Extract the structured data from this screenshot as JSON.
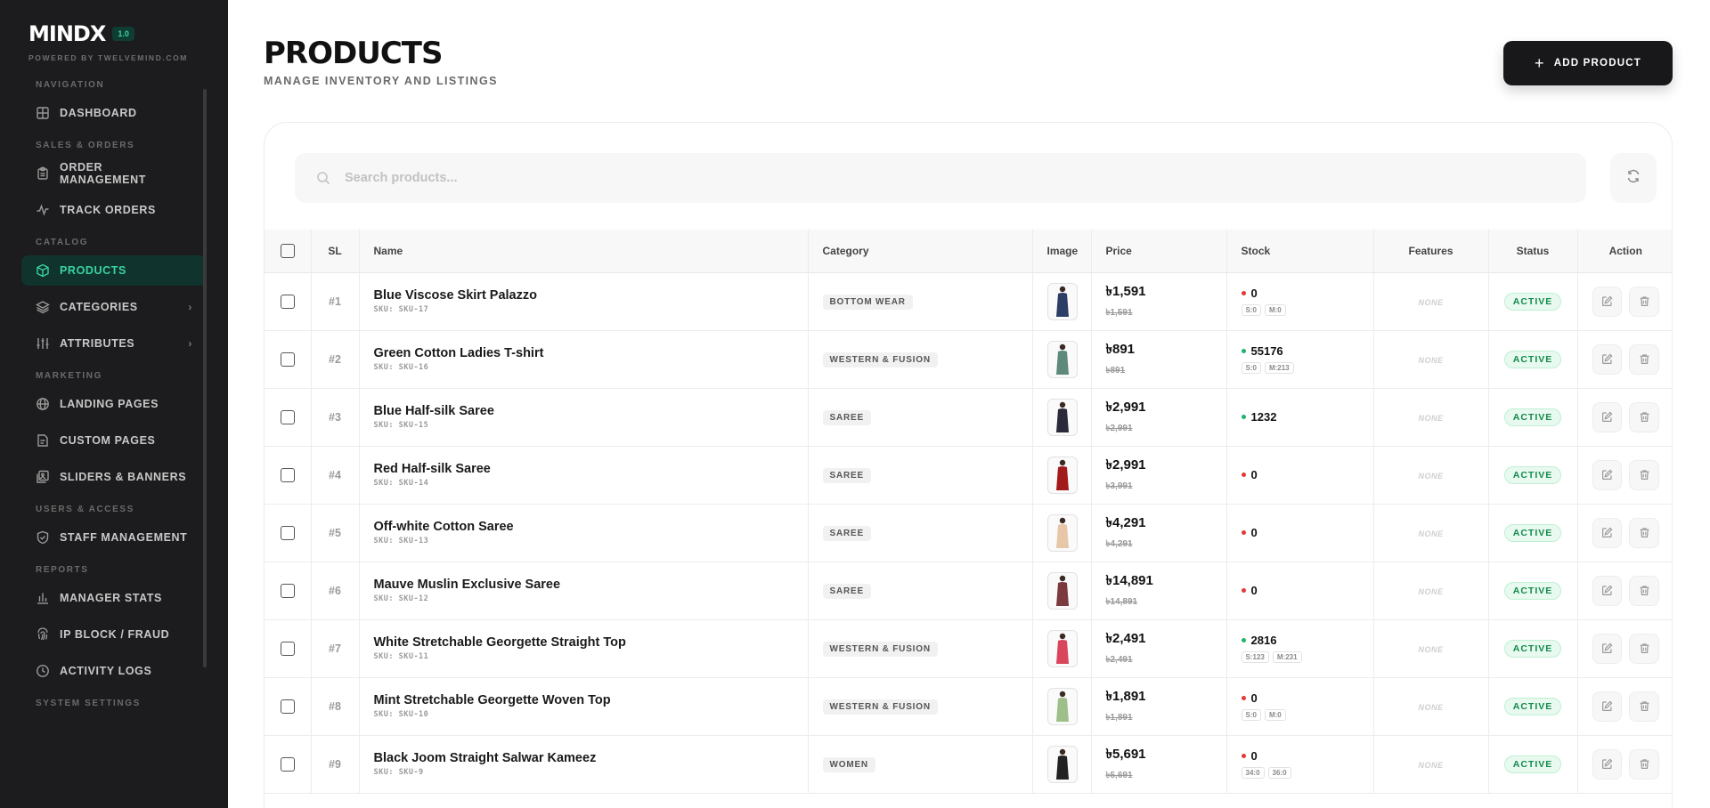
{
  "brand": {
    "logo": "MINDX",
    "version": "1.0",
    "powered_by": "POWERED BY TWELVEMIND.COM"
  },
  "sidebar": {
    "sections": [
      {
        "label": "NAVIGATION",
        "items": [
          {
            "label": "DASHBOARD",
            "icon": "dashboard-icon"
          }
        ]
      },
      {
        "label": "SALES & ORDERS",
        "items": [
          {
            "label": "ORDER MANAGEMENT",
            "icon": "clipboard-icon"
          },
          {
            "label": "TRACK ORDERS",
            "icon": "activity-icon"
          }
        ]
      },
      {
        "label": "CATALOG",
        "items": [
          {
            "label": "PRODUCTS",
            "icon": "box-icon",
            "active": true
          },
          {
            "label": "CATEGORIES",
            "icon": "layers-icon",
            "has_children": true
          },
          {
            "label": "ATTRIBUTES",
            "icon": "sliders-icon",
            "has_children": true
          }
        ]
      },
      {
        "label": "MARKETING",
        "items": [
          {
            "label": "LANDING PAGES",
            "icon": "globe-icon"
          },
          {
            "label": "CUSTOM PAGES",
            "icon": "page-icon"
          },
          {
            "label": "SLIDERS & BANNERS",
            "icon": "images-icon"
          }
        ]
      },
      {
        "label": "USERS & ACCESS",
        "items": [
          {
            "label": "STAFF MANAGEMENT",
            "icon": "shield-icon"
          }
        ]
      },
      {
        "label": "REPORTS",
        "items": [
          {
            "label": "MANAGER STATS",
            "icon": "bar-chart-icon"
          },
          {
            "label": "IP BLOCK / FRAUD",
            "icon": "fingerprint-icon"
          },
          {
            "label": "ACTIVITY LOGS",
            "icon": "clock-icon"
          }
        ]
      },
      {
        "label": "SYSTEM SETTINGS",
        "items": []
      }
    ]
  },
  "header": {
    "title": "PRODUCTS",
    "subtitle": "MANAGE INVENTORY AND LISTINGS",
    "add_label": "ADD PRODUCT"
  },
  "search": {
    "placeholder": "Search products..."
  },
  "table": {
    "columns": {
      "sl": "SL",
      "name": "Name",
      "category": "Category",
      "image": "Image",
      "price": "Price",
      "stock": "Stock",
      "features": "Features",
      "status": "Status",
      "action": "Action"
    },
    "rows": [
      {
        "sl": "#1",
        "name": "Blue Viscose Skirt Palazzo",
        "sku": "SKU: SKU-17",
        "category": "BOTTOM WEAR",
        "price": "৳1,591",
        "old_price": "৳1,591",
        "stock": "0",
        "stock_level": "out",
        "tags": [
          "S:0",
          "M:0"
        ],
        "features": "NONE",
        "status": "ACTIVE",
        "thumb_color": "#2c3e66"
      },
      {
        "sl": "#2",
        "name": "Green Cotton Ladies T-shirt",
        "sku": "SKU: SKU-16",
        "category": "WESTERN & FUSION",
        "price": "৳891",
        "old_price": "৳891",
        "stock": "55176",
        "stock_level": "in",
        "tags": [
          "S:0",
          "M:213"
        ],
        "features": "NONE",
        "status": "ACTIVE",
        "thumb_color": "#5d8a7a"
      },
      {
        "sl": "#3",
        "name": "Blue Half-silk Saree",
        "sku": "SKU: SKU-15",
        "category": "SAREE",
        "price": "৳2,991",
        "old_price": "৳2,991",
        "stock": "1232",
        "stock_level": "in",
        "tags": [],
        "features": "NONE",
        "status": "ACTIVE",
        "thumb_color": "#2a2a3a"
      },
      {
        "sl": "#4",
        "name": "Red Half-silk Saree",
        "sku": "SKU: SKU-14",
        "category": "SAREE",
        "price": "৳2,991",
        "old_price": "৳3,991",
        "stock": "0",
        "stock_level": "out",
        "tags": [],
        "features": "NONE",
        "status": "ACTIVE",
        "thumb_color": "#a31a1a"
      },
      {
        "sl": "#5",
        "name": "Off-white Cotton Saree",
        "sku": "SKU: SKU-13",
        "category": "SAREE",
        "price": "৳4,291",
        "old_price": "৳4,291",
        "stock": "0",
        "stock_level": "out",
        "tags": [],
        "features": "NONE",
        "status": "ACTIVE",
        "thumb_color": "#e8c7a8"
      },
      {
        "sl": "#6",
        "name": "Mauve Muslin Exclusive Saree",
        "sku": "SKU: SKU-12",
        "category": "SAREE",
        "price": "৳14,891",
        "old_price": "৳14,891",
        "stock": "0",
        "stock_level": "out",
        "tags": [],
        "features": "NONE",
        "status": "ACTIVE",
        "thumb_color": "#7a3a3e"
      },
      {
        "sl": "#7",
        "name": "White Stretchable Georgette Straight Top",
        "sku": "SKU: SKU-11",
        "category": "WESTERN & FUSION",
        "price": "৳2,491",
        "old_price": "৳2,491",
        "stock": "2816",
        "stock_level": "in",
        "tags": [
          "S:123",
          "M:231"
        ],
        "features": "NONE",
        "status": "ACTIVE",
        "thumb_color": "#d9455a"
      },
      {
        "sl": "#8",
        "name": "Mint Stretchable Georgette Woven Top",
        "sku": "SKU: SKU-10",
        "category": "WESTERN & FUSION",
        "price": "৳1,891",
        "old_price": "৳1,891",
        "stock": "0",
        "stock_level": "out",
        "tags": [
          "S:0",
          "M:0"
        ],
        "features": "NONE",
        "status": "ACTIVE",
        "thumb_color": "#9fbf8a"
      },
      {
        "sl": "#9",
        "name": "Black Joom Straight Salwar Kameez",
        "sku": "SKU: SKU-9",
        "category": "WOMEN",
        "price": "৳5,691",
        "old_price": "৳5,691",
        "stock": "0",
        "stock_level": "out",
        "tags": [
          "34:0",
          "36:0"
        ],
        "features": "NONE",
        "status": "ACTIVE",
        "thumb_color": "#222"
      }
    ]
  },
  "colors": {
    "accent": "#3ad29f",
    "stock_in": "#22b36b",
    "stock_out": "#e53935",
    "sidebar_bg": "#1c1c1e"
  }
}
